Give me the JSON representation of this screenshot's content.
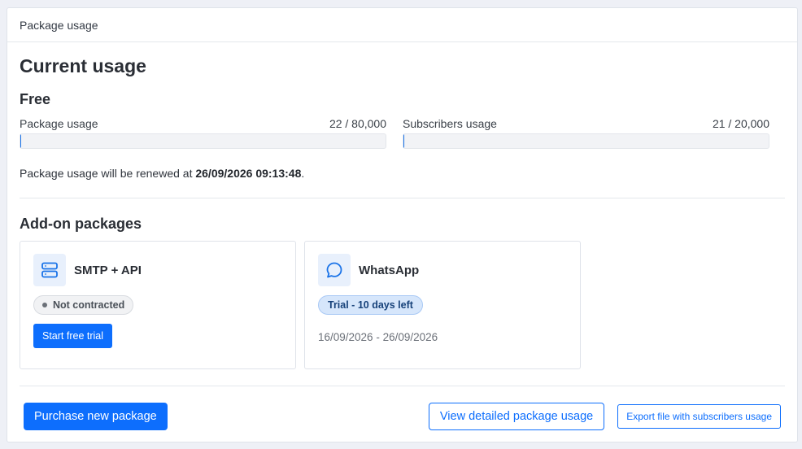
{
  "header": {
    "title": "Package usage"
  },
  "main": {
    "title": "Current usage",
    "plan_name": "Free",
    "usage": [
      {
        "label": "Package usage",
        "value_text": "22 / 80,000",
        "fraction": 0.000275
      },
      {
        "label": "Subscribers usage",
        "value_text": "21 / 20,000",
        "fraction": 0.00105
      }
    ],
    "renew": {
      "prefix": "Package usage will be renewed at ",
      "date": "26/09/2026 09:13:48",
      "suffix": "."
    }
  },
  "addons": {
    "title": "Add-on packages",
    "items": [
      {
        "name": "SMTP + API",
        "icon": "server-icon",
        "status": "Not contracted",
        "button_label": "Start free trial"
      },
      {
        "name": "WhatsApp",
        "icon": "chat-bubble-icon",
        "status": "Trial - 10 days left",
        "dates": "16/09/2026 - 26/09/2026"
      }
    ]
  },
  "footer": {
    "purchase_label": "Purchase new package",
    "view_detail_label": "View detailed package usage",
    "export_label": "Export file with subscribers usage"
  },
  "colors": {
    "primary": "#0d6efd",
    "icon_bg": "#e8f0fc",
    "trial_pill_bg": "#d6e6fb",
    "trial_pill_text": "#17427a"
  }
}
